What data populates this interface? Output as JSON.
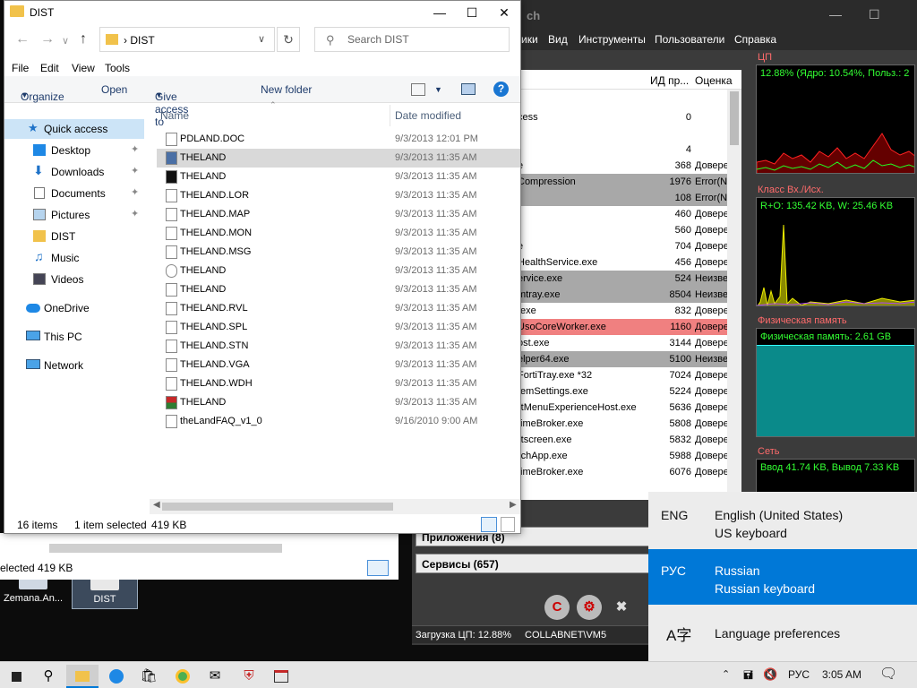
{
  "desktop": {
    "icons": [
      {
        "label": "Zemana.An...",
        "icon": "shield-icon"
      },
      {
        "label": "DIST",
        "icon": "folder-icon"
      }
    ],
    "back_window_status": "elected  419 KB"
  },
  "process_hacker": {
    "title_fragment": "ch",
    "menu": [
      "ики",
      "Вид",
      "Инструменты",
      "Пользователи",
      "Справка"
    ],
    "columns": [
      "ИД пр...",
      "Оценка"
    ],
    "rows": [
      {
        "name": "cess",
        "pid": "0",
        "rating": ""
      },
      {
        "name": "",
        "pid": "",
        "rating": ""
      },
      {
        "name": "",
        "pid": "4",
        "rating": ""
      },
      {
        "name": "e",
        "pid": "368",
        "rating": "Довере"
      },
      {
        "name": "Compression",
        "pid": "1976",
        "rating": "Error(N"
      },
      {
        "name": "",
        "pid": "108",
        "rating": "Error(N"
      },
      {
        "name": "",
        "pid": "460",
        "rating": "Довере"
      },
      {
        "name": "",
        "pid": "560",
        "rating": "Довере"
      },
      {
        "name": "e",
        "pid": "704",
        "rating": "Довере"
      },
      {
        "name": "HealthService.exe",
        "pid": "456",
        "rating": "Довере"
      },
      {
        "name": "ervice.exe",
        "pid": "524",
        "rating": "Неизве"
      },
      {
        "name": "mtray.exe",
        "pid": "8504",
        "rating": "Неизве"
      },
      {
        "name": ".exe",
        "pid": "832",
        "rating": "Довере"
      },
      {
        "name": "UsoCoreWorker.exe",
        "pid": "1160",
        "rating": "Довере"
      },
      {
        "name": "ost.exe",
        "pid": "3144",
        "rating": "Довере"
      },
      {
        "name": "elper64.exe",
        "pid": "5100",
        "rating": "Неизве"
      },
      {
        "name": "FortiTray.exe *32",
        "pid": "7024",
        "rating": "Довере"
      },
      {
        "name": "temSettings.exe",
        "pid": "5224",
        "rating": "Довере"
      },
      {
        "name": "rtMenuExperienceHost.exe",
        "pid": "5636",
        "rating": "Довере"
      },
      {
        "name": "timeBroker.exe",
        "pid": "5808",
        "rating": "Довере"
      },
      {
        "name": "rtscreen.exe",
        "pid": "5832",
        "rating": "Довере"
      },
      {
        "name": "rchApp.exe",
        "pid": "5988",
        "rating": "Довере"
      },
      {
        "name": "timeBroker.exe",
        "pid": "6076",
        "rating": "Довере"
      }
    ],
    "sections": [
      "Приложения (8)",
      "Сервисы (657)"
    ],
    "graphs": [
      {
        "label": "ЦП",
        "text": "12.88% (Ядро: 10.54%, Польз.: 2"
      },
      {
        "label": "Класс Вх./Исх.",
        "text": "R+O: 135.42 KB, W: 25.46 KB"
      },
      {
        "label": "Физическая память",
        "text": "Физическая память: 2.61 GB"
      },
      {
        "label": "Сеть",
        "text": "Ввод 41.74 KB, Вывод 7.33 KB"
      }
    ],
    "status_cpu": "Загрузка ЦП: 12.88%",
    "status_user": "COLLABNET\\VM5"
  },
  "explorer": {
    "title": "DIST",
    "address": "DIST",
    "search_placeholder": "Search DIST",
    "menu": [
      "File",
      "Edit",
      "View",
      "Tools"
    ],
    "toolbar": {
      "organize": "Organize",
      "open": "Open",
      "give_access": "Give access to",
      "new_folder": "New folder",
      "help": "?"
    },
    "nav": [
      {
        "label": "Quick access",
        "icon": "star-icon"
      },
      {
        "label": "Desktop",
        "icon": "desktop-icon"
      },
      {
        "label": "Downloads",
        "icon": "download-icon"
      },
      {
        "label": "Documents",
        "icon": "document-icon"
      },
      {
        "label": "Pictures",
        "icon": "picture-icon"
      },
      {
        "label": "DIST",
        "icon": "folder-icon"
      },
      {
        "label": "Music",
        "icon": "music-icon"
      },
      {
        "label": "Videos",
        "icon": "video-icon"
      },
      {
        "label": "OneDrive",
        "icon": "cloud-icon"
      },
      {
        "label": "This PC",
        "icon": "computer-icon"
      },
      {
        "label": "Network",
        "icon": "network-icon"
      }
    ],
    "columns": {
      "name": "Name",
      "date": "Date modified"
    },
    "files": [
      {
        "name": "PDLAND.DOC",
        "date": "9/3/2013 12:01 PM"
      },
      {
        "name": "THELAND",
        "date": "9/3/2013 11:35 AM"
      },
      {
        "name": "THELAND",
        "date": "9/3/2013 11:35 AM"
      },
      {
        "name": "THELAND.LOR",
        "date": "9/3/2013 11:35 AM"
      },
      {
        "name": "THELAND.MAP",
        "date": "9/3/2013 11:35 AM"
      },
      {
        "name": "THELAND.MON",
        "date": "9/3/2013 11:35 AM"
      },
      {
        "name": "THELAND.MSG",
        "date": "9/3/2013 11:35 AM"
      },
      {
        "name": "THELAND",
        "date": "9/3/2013 11:35 AM"
      },
      {
        "name": "THELAND",
        "date": "9/3/2013 11:35 AM"
      },
      {
        "name": "THELAND.RVL",
        "date": "9/3/2013 11:35 AM"
      },
      {
        "name": "THELAND.SPL",
        "date": "9/3/2013 11:35 AM"
      },
      {
        "name": "THELAND.STN",
        "date": "9/3/2013 11:35 AM"
      },
      {
        "name": "THELAND.VGA",
        "date": "9/3/2013 11:35 AM"
      },
      {
        "name": "THELAND.WDH",
        "date": "9/3/2013 11:35 AM"
      },
      {
        "name": "THELAND",
        "date": "9/3/2013 11:35 AM"
      },
      {
        "name": "theLandFAQ_v1_0",
        "date": "9/16/2010 9:00 AM"
      }
    ],
    "status": {
      "items": "16 items",
      "selected": "1 item selected",
      "size": "419 KB"
    }
  },
  "language": {
    "options": [
      {
        "code": "ENG",
        "name": "English (United States)",
        "keyboard": "US keyboard"
      },
      {
        "code": "РУС",
        "name": "Russian",
        "keyboard": "Russian keyboard"
      }
    ],
    "preferences": "Language preferences"
  },
  "taskbar": {
    "lang": "РУС",
    "time": "3:05 AM"
  }
}
